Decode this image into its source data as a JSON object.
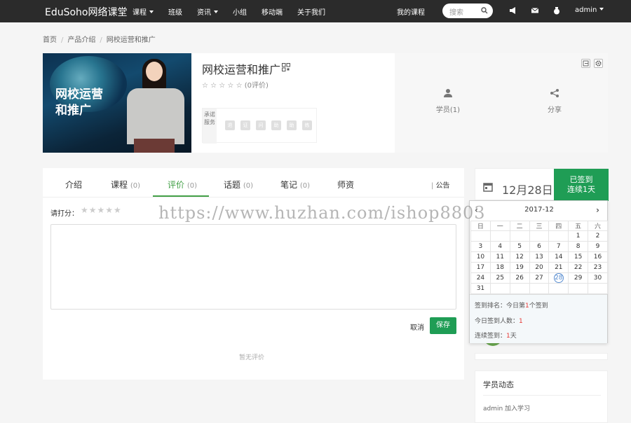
{
  "nav": {
    "brand": "EduSoho网络课堂",
    "items": [
      {
        "label": "课程",
        "dropdown": true
      },
      {
        "label": "班级",
        "dropdown": false
      },
      {
        "label": "资讯",
        "dropdown": true
      },
      {
        "label": "小组",
        "dropdown": false
      },
      {
        "label": "移动端",
        "dropdown": false
      },
      {
        "label": "关于我们",
        "dropdown": false
      }
    ],
    "my_courses": "我的课程",
    "search_placeholder": "搜索",
    "user": "admin"
  },
  "breadcrumb": [
    "首页",
    "产品介绍",
    "网校运营和推广"
  ],
  "course": {
    "cover_line1": "网校运营",
    "cover_line2": "和推广",
    "title": "网校运营和推广",
    "rating_stars": "☆ ☆ ☆ ☆ ☆",
    "rating_text": "(0评价)",
    "promise_label": "承诺服务",
    "promise_badges": [
      "退",
      "证",
      "问",
      "助",
      "助",
      "练"
    ],
    "students_label": "学员(1)",
    "share_label": "分享"
  },
  "tabs": [
    {
      "label": "介绍",
      "count": ""
    },
    {
      "label": "课程",
      "count": "(0)"
    },
    {
      "label": "评价",
      "count": "(0)"
    },
    {
      "label": "话题",
      "count": "(0)"
    },
    {
      "label": "笔记",
      "count": "(0)"
    },
    {
      "label": "师资",
      "count": ""
    }
  ],
  "active_tab": "评价",
  "announcement": "公告",
  "review": {
    "rate_label": "请打分：",
    "rate_stars": "★★★★★",
    "cancel": "取消",
    "save": "保存",
    "empty": "暂无评价"
  },
  "checkin": {
    "date": "12月28日",
    "signed_line1": "已签到",
    "signed_line2": "连续1天"
  },
  "calendar": {
    "month": "2017-12",
    "weekdays": [
      "日",
      "一",
      "二",
      "三",
      "四",
      "五",
      "六"
    ],
    "weeks": [
      [
        "",
        "",
        "",
        "",
        "",
        "1",
        "2"
      ],
      [
        "3",
        "4",
        "5",
        "6",
        "7",
        "8",
        "9"
      ],
      [
        "10",
        "11",
        "12",
        "13",
        "14",
        "15",
        "16"
      ],
      [
        "17",
        "18",
        "19",
        "20",
        "21",
        "22",
        "23"
      ],
      [
        "24",
        "25",
        "26",
        "27",
        "28",
        "29",
        "30"
      ],
      [
        "31",
        "",
        "",
        "",
        "",
        "",
        ""
      ]
    ],
    "today": "28",
    "rank_prefix": "签到排名：今日第",
    "rank_num": "1",
    "rank_suffix": "个签到",
    "count_prefix": "今日签到人数：",
    "count_num": "1",
    "streak_prefix": "连续签到：",
    "streak_num": "1",
    "streak_suffix": "天"
  },
  "activity": {
    "title": "学员动态",
    "item": "admin 加入学习"
  },
  "watermark": "https://www.huzhan.com/ishop8803",
  "colors": {
    "accent": "#43a047",
    "button": "#1f9d55",
    "topbar": "#2b2b2b"
  }
}
